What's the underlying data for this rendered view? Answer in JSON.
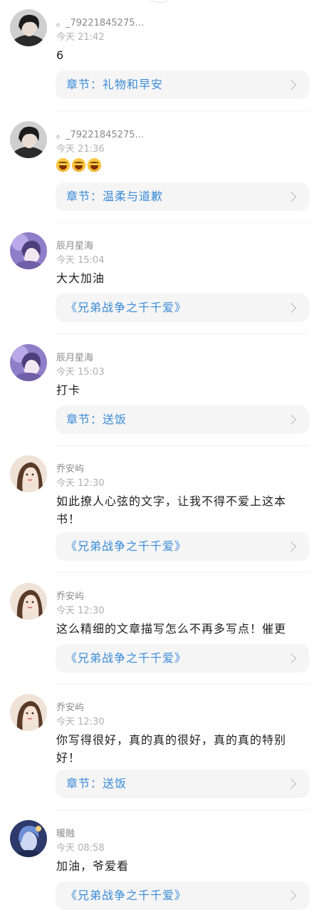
{
  "comments": [
    {
      "username": "。_79221845275…",
      "time": "今天 21:42",
      "content": "6",
      "source": "章节：礼物和早安"
    },
    {
      "username": "。_79221845275…",
      "time": "今天 21:36",
      "emoji": [
        "laughing-tears-emoji",
        "laughing-tears-emoji",
        "laughing-tears-emoji"
      ],
      "source": "章节：温柔与道歉"
    },
    {
      "username": "辰月星海",
      "time": "今天 15:04",
      "content": "大大加油",
      "source": "《兄弟战争之千千爱》"
    },
    {
      "username": "辰月星海",
      "time": "今天 15:03",
      "content": "打卡",
      "source": "章节：送饭"
    },
    {
      "username": "乔安屿",
      "time": "今天 12:30",
      "content": "如此撩人心弦的文字，让我不得不爱上这本书！",
      "source": "《兄弟战争之千千爱》"
    },
    {
      "username": "乔安屿",
      "time": "今天 12:30",
      "content": "这么精细的文章描写怎么不再多写点！催更",
      "source": "《兄弟战争之千千爱》"
    },
    {
      "username": "乔安屿",
      "time": "今天 12:30",
      "content": "你写得很好，真的真的很好，真的真的特别好！",
      "source": "章节：送饭"
    },
    {
      "username": "暖融",
      "time": "今天 08:58",
      "content": "加油，爷爱看",
      "source": "《兄弟战争之千千爱》"
    }
  ]
}
